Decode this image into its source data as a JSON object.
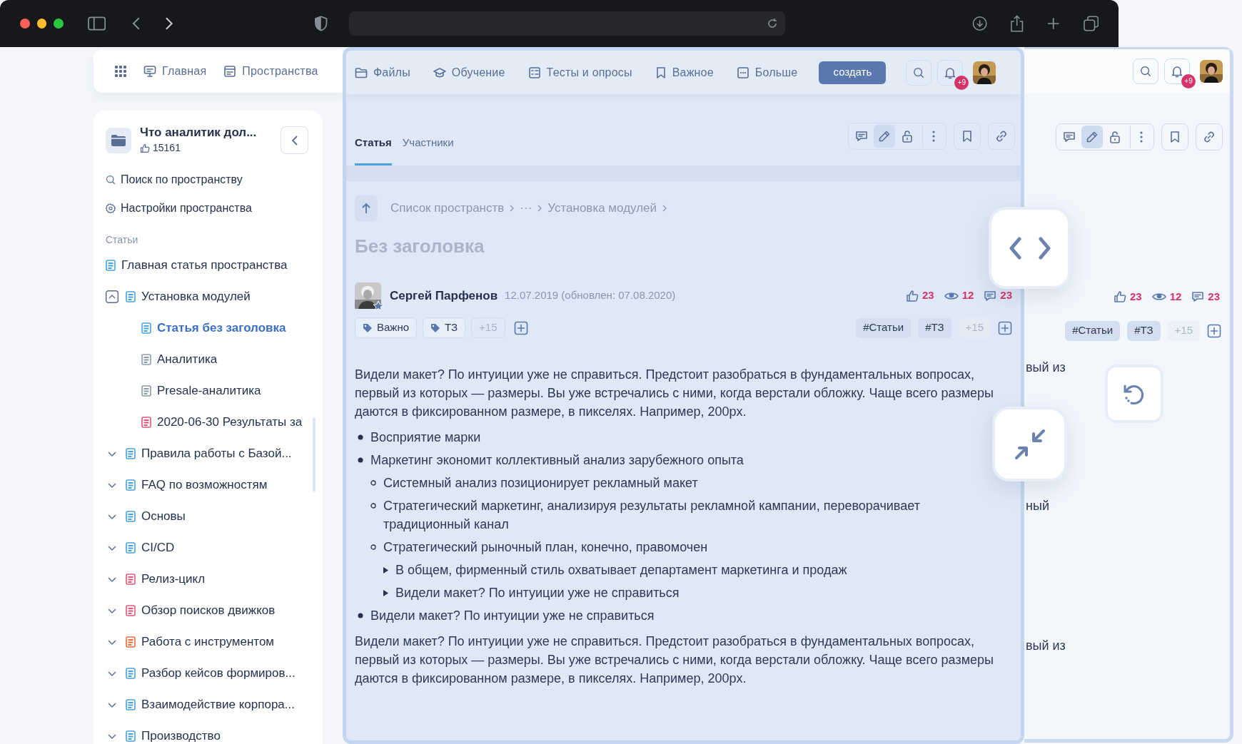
{
  "nav": {
    "items": [
      {
        "label": "Главная",
        "kind": "home"
      },
      {
        "label": "Пространства",
        "kind": "spaces"
      },
      {
        "label": "Файлы",
        "kind": "folder"
      },
      {
        "label": "Обучение",
        "kind": "education"
      },
      {
        "label": "Тесты и опросы",
        "kind": "tests"
      },
      {
        "label": "Важное",
        "kind": "bookmark"
      },
      {
        "label": "Больше",
        "kind": "more"
      }
    ],
    "create_button": "создать",
    "notifications_badge": "+9"
  },
  "sidebar": {
    "space_title": "Что аналитик дол...",
    "likes": "15161",
    "actions": [
      {
        "label": "Поиск по пространству",
        "kind": "search"
      },
      {
        "label": "Настройки пространства",
        "kind": "settings"
      }
    ],
    "section_label": "Статьи",
    "tree": [
      {
        "label": "Главная статья пространства",
        "color": "#4aa3d8",
        "selected": false
      },
      {
        "label": "Установка модулей",
        "color": "#4aa3d8",
        "selected": false,
        "expanded": true,
        "children": [
          {
            "label": "Статья без заголовка",
            "color": "#4aa3d8",
            "selected": true
          },
          {
            "label": "Аналитика",
            "color": "#8e99a8",
            "selected": false
          },
          {
            "label": "Presale-аналитика",
            "color": "#8e99a8",
            "selected": false
          },
          {
            "label": "2020-06-30 Результаты за",
            "color": "#e0587c",
            "selected": false
          }
        ]
      },
      {
        "label": "Правила работы с Базой...",
        "color": "#4aa3d8",
        "selected": false,
        "expanded": false
      },
      {
        "label": "FAQ по возможностям",
        "color": "#4aa3d8",
        "selected": false,
        "expanded": false
      },
      {
        "label": "Основы",
        "color": "#4aa3d8",
        "selected": false,
        "expanded": false
      },
      {
        "label": "CI/CD",
        "color": "#4aa3d8",
        "selected": false,
        "expanded": false
      },
      {
        "label": "Релиз-цикл",
        "color": "#e0587c",
        "selected": false,
        "expanded": false
      },
      {
        "label": "Обзор поисков движков",
        "color": "#e0587c",
        "selected": false,
        "expanded": false
      },
      {
        "label": "Работа с инструментом",
        "color": "#ef6c3e",
        "selected": false,
        "expanded": false
      },
      {
        "label": "Разбор кейсов формиров...",
        "color": "#4aa3d8",
        "selected": false,
        "expanded": false
      },
      {
        "label": "Взаимодействие корпора...",
        "color": "#4aa3d8",
        "selected": false,
        "expanded": false
      },
      {
        "label": "Производство",
        "color": "#4aa3d8",
        "selected": false,
        "expanded": false
      }
    ]
  },
  "article": {
    "tabs": [
      {
        "label": "Статья",
        "selected": true
      },
      {
        "label": "Участники",
        "selected": false
      }
    ],
    "toolbar": [
      {
        "kind": "comment",
        "selected": false
      },
      {
        "kind": "edit",
        "selected": true
      },
      {
        "kind": "lock",
        "selected": false
      },
      {
        "kind": "more",
        "selected": false
      },
      {
        "kind": "bookmark",
        "selected": false
      },
      {
        "kind": "link",
        "selected": false
      }
    ],
    "breadcrumb": [
      "Список пространств",
      "···",
      "Установка модулей"
    ],
    "title": "Без заголовка",
    "author": {
      "name": "Сергей Парфенов",
      "date": "12.07.2019 (обновлен: 07.08.2020)"
    },
    "stats": {
      "likes": "23",
      "views": "12",
      "comments": "23"
    },
    "tags": [
      {
        "label": "Важно",
        "kind": "tag"
      },
      {
        "label": "ТЗ",
        "kind": "tag"
      },
      {
        "label": "+15",
        "kind": "more"
      }
    ],
    "hashtags": [
      {
        "label": "#Статьи",
        "kind": "tag"
      },
      {
        "label": "#ТЗ",
        "kind": "tag"
      },
      {
        "label": "+15",
        "kind": "more"
      }
    ],
    "body": [
      {
        "kind": "paragraph",
        "text": "Видели макет? По интуиции уже не справиться. Предстоит разобраться в фундаментальных вопросах, первый из которых — размеры. Вы уже встречались с ними, когда верстали обложку. Чаще всего размеры даются в фиксированном размере, в пикселях. Например, 200px."
      },
      {
        "kind": "list",
        "items": [
          {
            "text": "Восприятие марки"
          },
          {
            "text": "Маркетинг экономит коллективный анализ зарубежного опыта",
            "children": [
              {
                "text": "Системный анализ позиционирует рекламный макет"
              },
              {
                "text": "Стратегический маркетинг, анализируя результаты рекламной кампании, переворачивает традиционный канал"
              },
              {
                "text": "Стратегический рыночный план, конечно, правомочен",
                "children": [
                  {
                    "text": "В общем, фирменный стиль охватывает департамент маркетинга и продаж"
                  },
                  {
                    "text": "Видели макет? По интуиции уже не справиться"
                  }
                ]
              }
            ]
          },
          {
            "text": "Видели макет? По интуиции уже не справиться"
          }
        ]
      },
      {
        "kind": "paragraph",
        "text": "Видели макет? По интуиции уже не справиться. Предстоит разобраться в фундаментальных вопросах, первый из которых — размеры. Вы уже встречались с ними, когда верстали обложку. Чаще всего размеры даются в фиксированном размере, в пикселях. Например, 200px."
      }
    ]
  },
  "ghost": {
    "notifications_badge": "+9",
    "toolbar": [
      {
        "kind": "comment",
        "selected": false
      },
      {
        "kind": "edit",
        "selected": true
      },
      {
        "kind": "lock",
        "selected": false
      },
      {
        "kind": "more",
        "selected": false
      },
      {
        "kind": "bookmark",
        "selected": false
      },
      {
        "kind": "link",
        "selected": false
      }
    ],
    "stats": {
      "likes": "23",
      "views": "12",
      "comments": "23"
    },
    "hashtags": [
      {
        "label": "#Статьи",
        "kind": "tag"
      },
      {
        "label": "#ТЗ",
        "kind": "tag"
      },
      {
        "label": "+15",
        "kind": "more"
      }
    ],
    "fragments": [
      "вый из",
      "ный",
      "вый из"
    ]
  }
}
